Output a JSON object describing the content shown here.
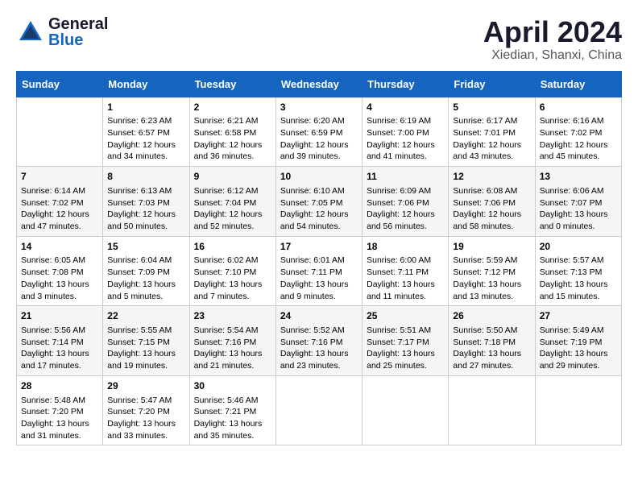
{
  "header": {
    "logo_general": "General",
    "logo_blue": "Blue",
    "month": "April 2024",
    "location": "Xiedian, Shanxi, China"
  },
  "weekdays": [
    "Sunday",
    "Monday",
    "Tuesday",
    "Wednesday",
    "Thursday",
    "Friday",
    "Saturday"
  ],
  "weeks": [
    [
      {
        "day": "",
        "info": ""
      },
      {
        "day": "1",
        "info": "Sunrise: 6:23 AM\nSunset: 6:57 PM\nDaylight: 12 hours\nand 34 minutes."
      },
      {
        "day": "2",
        "info": "Sunrise: 6:21 AM\nSunset: 6:58 PM\nDaylight: 12 hours\nand 36 minutes."
      },
      {
        "day": "3",
        "info": "Sunrise: 6:20 AM\nSunset: 6:59 PM\nDaylight: 12 hours\nand 39 minutes."
      },
      {
        "day": "4",
        "info": "Sunrise: 6:19 AM\nSunset: 7:00 PM\nDaylight: 12 hours\nand 41 minutes."
      },
      {
        "day": "5",
        "info": "Sunrise: 6:17 AM\nSunset: 7:01 PM\nDaylight: 12 hours\nand 43 minutes."
      },
      {
        "day": "6",
        "info": "Sunrise: 6:16 AM\nSunset: 7:02 PM\nDaylight: 12 hours\nand 45 minutes."
      }
    ],
    [
      {
        "day": "7",
        "info": "Sunrise: 6:14 AM\nSunset: 7:02 PM\nDaylight: 12 hours\nand 47 minutes."
      },
      {
        "day": "8",
        "info": "Sunrise: 6:13 AM\nSunset: 7:03 PM\nDaylight: 12 hours\nand 50 minutes."
      },
      {
        "day": "9",
        "info": "Sunrise: 6:12 AM\nSunset: 7:04 PM\nDaylight: 12 hours\nand 52 minutes."
      },
      {
        "day": "10",
        "info": "Sunrise: 6:10 AM\nSunset: 7:05 PM\nDaylight: 12 hours\nand 54 minutes."
      },
      {
        "day": "11",
        "info": "Sunrise: 6:09 AM\nSunset: 7:06 PM\nDaylight: 12 hours\nand 56 minutes."
      },
      {
        "day": "12",
        "info": "Sunrise: 6:08 AM\nSunset: 7:06 PM\nDaylight: 12 hours\nand 58 minutes."
      },
      {
        "day": "13",
        "info": "Sunrise: 6:06 AM\nSunset: 7:07 PM\nDaylight: 13 hours\nand 0 minutes."
      }
    ],
    [
      {
        "day": "14",
        "info": "Sunrise: 6:05 AM\nSunset: 7:08 PM\nDaylight: 13 hours\nand 3 minutes."
      },
      {
        "day": "15",
        "info": "Sunrise: 6:04 AM\nSunset: 7:09 PM\nDaylight: 13 hours\nand 5 minutes."
      },
      {
        "day": "16",
        "info": "Sunrise: 6:02 AM\nSunset: 7:10 PM\nDaylight: 13 hours\nand 7 minutes."
      },
      {
        "day": "17",
        "info": "Sunrise: 6:01 AM\nSunset: 7:11 PM\nDaylight: 13 hours\nand 9 minutes."
      },
      {
        "day": "18",
        "info": "Sunrise: 6:00 AM\nSunset: 7:11 PM\nDaylight: 13 hours\nand 11 minutes."
      },
      {
        "day": "19",
        "info": "Sunrise: 5:59 AM\nSunset: 7:12 PM\nDaylight: 13 hours\nand 13 minutes."
      },
      {
        "day": "20",
        "info": "Sunrise: 5:57 AM\nSunset: 7:13 PM\nDaylight: 13 hours\nand 15 minutes."
      }
    ],
    [
      {
        "day": "21",
        "info": "Sunrise: 5:56 AM\nSunset: 7:14 PM\nDaylight: 13 hours\nand 17 minutes."
      },
      {
        "day": "22",
        "info": "Sunrise: 5:55 AM\nSunset: 7:15 PM\nDaylight: 13 hours\nand 19 minutes."
      },
      {
        "day": "23",
        "info": "Sunrise: 5:54 AM\nSunset: 7:16 PM\nDaylight: 13 hours\nand 21 minutes."
      },
      {
        "day": "24",
        "info": "Sunrise: 5:52 AM\nSunset: 7:16 PM\nDaylight: 13 hours\nand 23 minutes."
      },
      {
        "day": "25",
        "info": "Sunrise: 5:51 AM\nSunset: 7:17 PM\nDaylight: 13 hours\nand 25 minutes."
      },
      {
        "day": "26",
        "info": "Sunrise: 5:50 AM\nSunset: 7:18 PM\nDaylight: 13 hours\nand 27 minutes."
      },
      {
        "day": "27",
        "info": "Sunrise: 5:49 AM\nSunset: 7:19 PM\nDaylight: 13 hours\nand 29 minutes."
      }
    ],
    [
      {
        "day": "28",
        "info": "Sunrise: 5:48 AM\nSunset: 7:20 PM\nDaylight: 13 hours\nand 31 minutes."
      },
      {
        "day": "29",
        "info": "Sunrise: 5:47 AM\nSunset: 7:20 PM\nDaylight: 13 hours\nand 33 minutes."
      },
      {
        "day": "30",
        "info": "Sunrise: 5:46 AM\nSunset: 7:21 PM\nDaylight: 13 hours\nand 35 minutes."
      },
      {
        "day": "",
        "info": ""
      },
      {
        "day": "",
        "info": ""
      },
      {
        "day": "",
        "info": ""
      },
      {
        "day": "",
        "info": ""
      }
    ]
  ]
}
